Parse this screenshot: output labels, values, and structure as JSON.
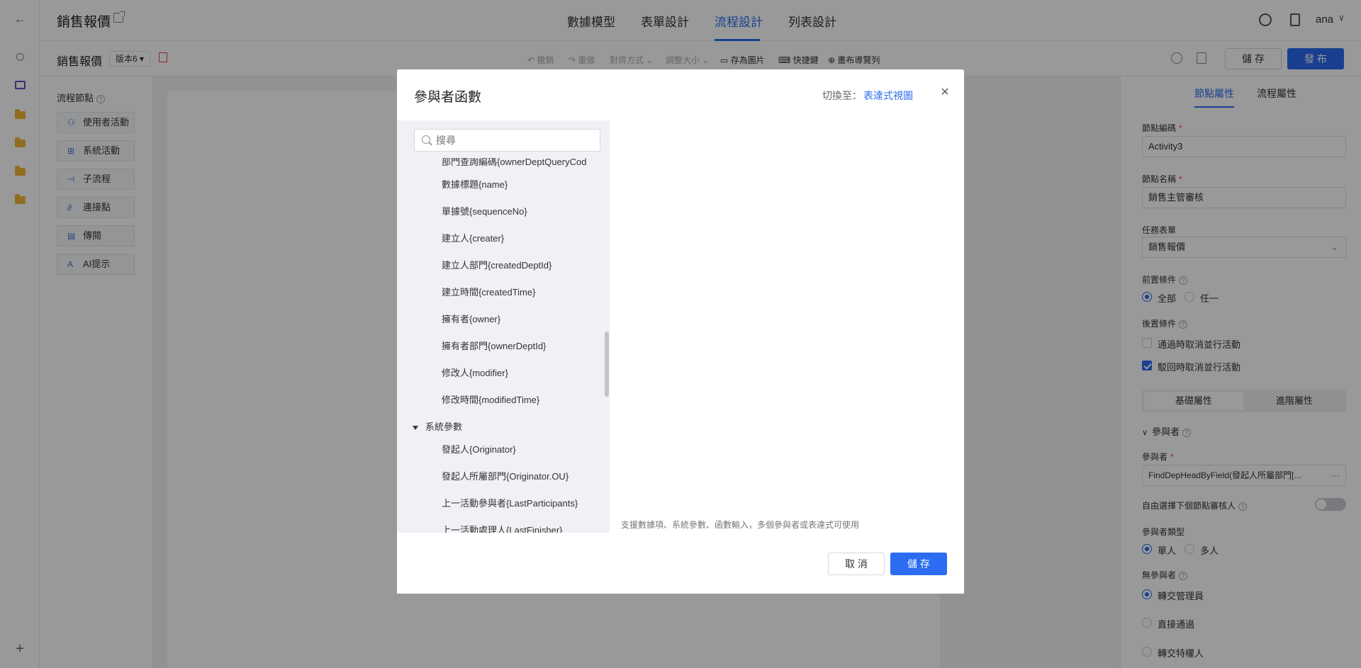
{
  "app": {
    "title": "銷售報價"
  },
  "nav_tabs": [
    "數據模型",
    "表單設計",
    "流程設計",
    "列表設計"
  ],
  "user": {
    "name": "ana"
  },
  "toolbar": {
    "doc_title": "銷售報價",
    "version": "版本6",
    "undo": "撤銷",
    "redo": "重做",
    "align": "對齊方式",
    "resize": "調整大小",
    "save_image": "存為圖片",
    "shortcuts": "快捷鍵",
    "canvas_nav": "畫布導覽列",
    "save": "儲 存",
    "publish": "發 布"
  },
  "palette": {
    "title": "流程節點",
    "items": [
      "使用者活動",
      "系統活動",
      "子流程",
      "連接點",
      "傳閱",
      "AI提示"
    ]
  },
  "right_panel": {
    "tabs": [
      "節點屬性",
      "流程屬性"
    ],
    "node_code_label": "節點編碼",
    "node_code": "Activity3",
    "node_name_label": "節點名稱",
    "node_name": "銷售主管審核",
    "task_form_label": "任務表單",
    "task_form": "銷售報價",
    "pre_cond_label": "前置條件",
    "pre_cond_options": [
      "全部",
      "任一"
    ],
    "post_cond_label": "後置條件",
    "post_cond_options": [
      "通過時取消並行活動",
      "駁回時取消並行活動"
    ],
    "seg_tabs": [
      "基礎屬性",
      "進階屬性"
    ],
    "participants_section": "參與者",
    "participants_label": "參與者",
    "participants_value": "FindDepHeadByField(發起人所屬部門[...",
    "free_select_label": "自由選擇下個節點審核人",
    "participant_type_label": "參與者類型",
    "participant_type_options": [
      "單人",
      "多人"
    ],
    "no_participant_label": "無參與者",
    "no_participant_options": [
      "轉交管理員",
      "直接通過",
      "轉交特權人"
    ]
  },
  "modal": {
    "title": "參與者函數",
    "switch_label": "切換至：",
    "switch_link": "表達式視圖",
    "search_placeholder": "搜尋",
    "tree_partial_top": "部門查詢編碼{ownerDeptQueryCod",
    "tree_items": [
      "數據標題{name}",
      "單據號{sequenceNo}",
      "建立人{creater}",
      "建立人部門{createdDeptId}",
      "建立時間{createdTime}",
      "擁有者{owner}",
      "擁有者部門{ownerDeptId}",
      "修改人{modifier}",
      "修改時間{modifiedTime}"
    ],
    "tree_group": "系統參數",
    "tree_group_items": [
      "發起人{Originator}",
      "發起人所屬部門{Originator.OU}",
      "上一活動參與者{LastParticipants}",
      "上一活動處理人{LastFinisher}"
    ],
    "hint": "支援數據項、系統參數、函數輸入，多個參與者或表達式可使用",
    "cancel": "取 消",
    "save": "儲 存"
  }
}
